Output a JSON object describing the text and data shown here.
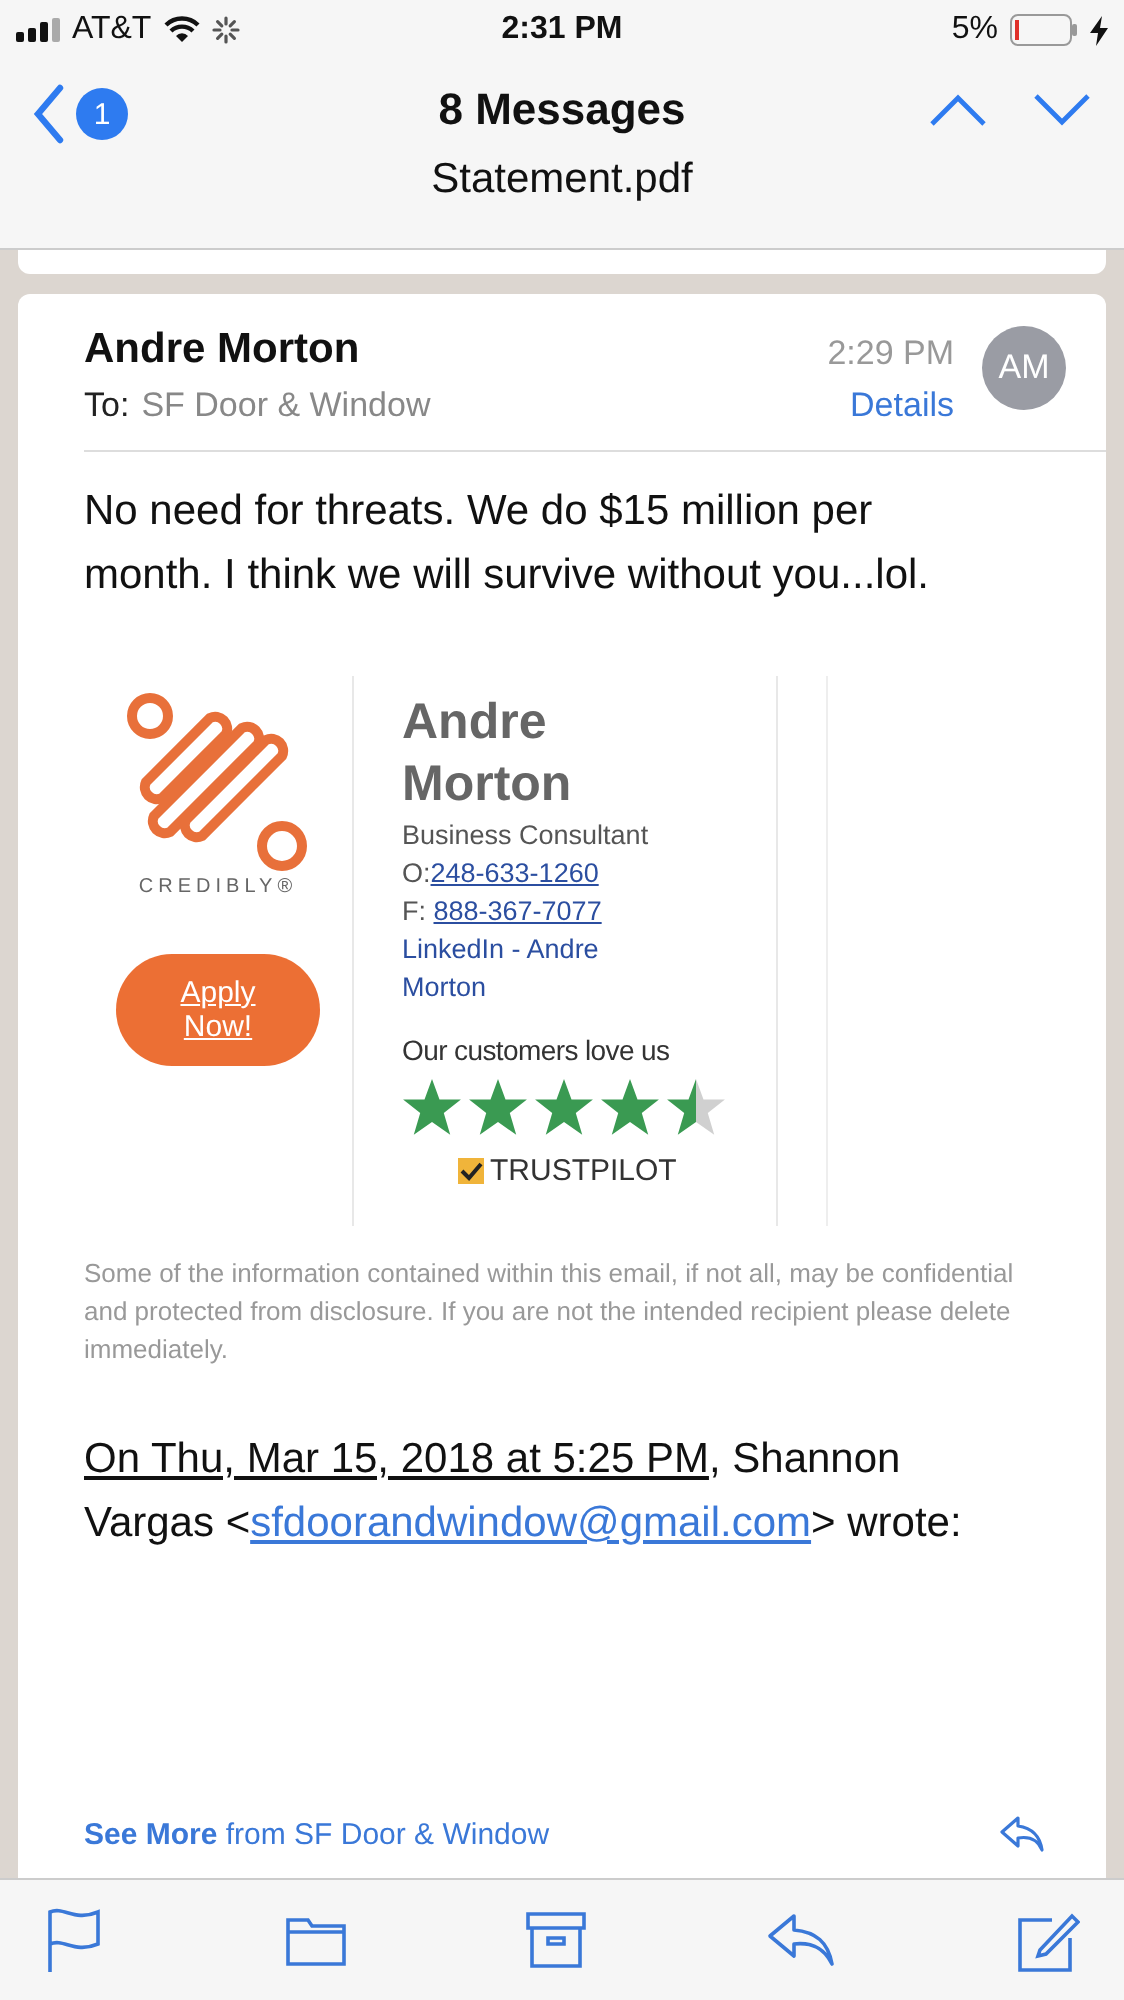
{
  "status_bar": {
    "carrier": "AT&T",
    "time": "2:31 PM",
    "battery": "5%"
  },
  "nav": {
    "unread_badge": "1",
    "title": "8 Messages",
    "subtitle": "Statement.pdf"
  },
  "message": {
    "sender": "Andre Morton",
    "to_label": "To:",
    "to": "SF Door & Window",
    "time": "2:29 PM",
    "details": "Details",
    "avatar": "AM",
    "body": "No need for threats. We do $15 million per month. I think we will survive without you...lol.",
    "signature": {
      "logo_text": "CREDIBLY®",
      "apply_button": "Apply Now!",
      "name": "Andre Morton",
      "title": "Business Consultant",
      "office_label": "O:",
      "office_phone": "248-633-1260",
      "fax_label": "F: ",
      "fax_phone": "888-367-7077",
      "linkedin": "LinkedIn - Andre Morton",
      "reviews_caption": "Our customers love us",
      "stars": 4.5,
      "review_brand": "TRUSTPILOT"
    },
    "disclaimer": "Some of the information contained within this email, if not all, may be confidential and protected from disclosure. If you are not the intended recipient please delete immediately.",
    "quote_header": [
      {
        "kind": "date",
        "text": "On Thu, Mar 15, 2018 at 5:25 PM"
      },
      {
        "kind": "plain",
        "text": ", Shannon Vargas <"
      },
      {
        "kind": "email",
        "text": "sfdoorandwindow@gmail.com"
      },
      {
        "kind": "plain",
        "text": "> wrote:"
      }
    ],
    "see_more": "**See More** from SF Door & Window"
  }
}
